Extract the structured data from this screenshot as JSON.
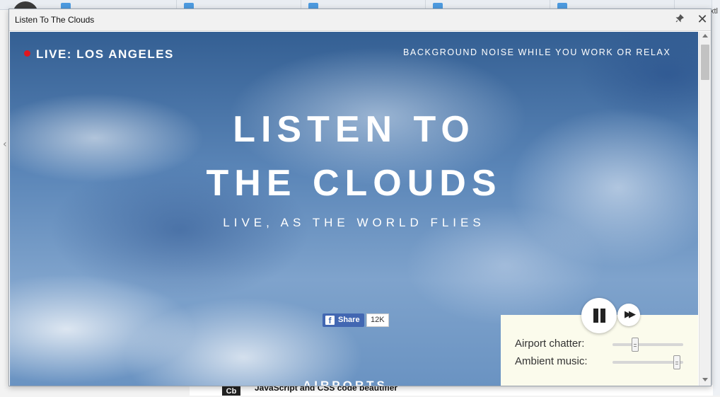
{
  "background": {
    "right_edge_text": "xtl",
    "bottom_badge": "Cb",
    "bottom_text": "JavaScript and CSS code beautifier"
  },
  "window": {
    "title": "Listen To The Clouds"
  },
  "page": {
    "live_label": "LIVE:  LOS ANGELES",
    "tagline": "BACKGROUND NOISE WHILE YOU WORK OR RELAX",
    "hero_line1": "LISTEN TO",
    "hero_line2": "THE CLOUDS",
    "subhero": "LIVE, AS THE WORLD FLIES",
    "share_label": "Share",
    "share_count": "12K",
    "bottom_heading": "AIRPORTS"
  },
  "mixer": {
    "airport_label": "Airport chatter:",
    "airport_level": 0.3,
    "ambient_label": "Ambient music:",
    "ambient_level": 0.95
  },
  "colors": {
    "live_dot": "#e0171f",
    "facebook": "#4267b2",
    "mixer_bg": "#fbfbec"
  }
}
